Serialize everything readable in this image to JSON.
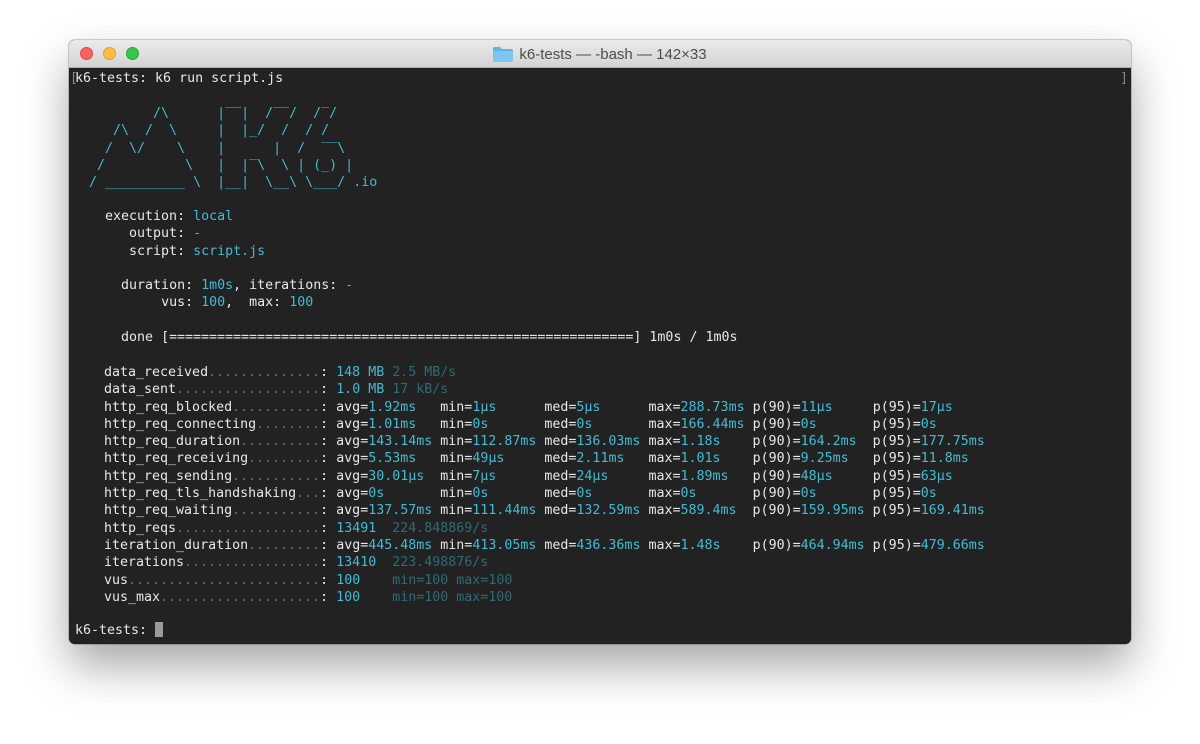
{
  "window": {
    "title": "k6-tests — -bash — 142×33",
    "folder_icon": "folder-icon",
    "traffic_lights": {
      "close": "#fc605c",
      "minimize": "#fdbc40",
      "maximize": "#34c84a"
    }
  },
  "terminal": {
    "bg_color": "#222222",
    "accent_color": "#3fbcd4",
    "command_line": "k6-tests: k6 run script.js",
    "logo": {
      "art": "        /\\      |‾‾|  /‾‾/  /‾/\n   /\\  /  \\     |  |_/  /  / /\n  /  \\/    \\    |      |  /  ‾‾\\\n /          \\   |  |‾\\  \\ | (_) |\n/ __________ \\  |__|  \\__\\ \\___/",
      "suffix": " .io"
    },
    "execution": {
      "execution_label": "execution:",
      "execution_value": "local",
      "output_label": "output:",
      "output_value": "-",
      "script_label": "script:",
      "script_value": "script.js",
      "duration_label": "duration:",
      "duration_value": "1m0s",
      "iterations_label": ", iterations:",
      "iterations_value": "-",
      "vus_label": "vus:",
      "vus_value": "100",
      "max_label": ",  max:",
      "max_value": "100"
    },
    "progress": {
      "label": "done",
      "bar": "[==========================================================]",
      "value_text": "1m0s / 1m0s",
      "fraction": 1.0
    },
    "metrics": [
      {
        "name": "data_received",
        "dots": "..............:",
        "value": "148 MB",
        "rate": "2.5 MB/s"
      },
      {
        "name": "data_sent",
        "dots": "..................:",
        "value": "1.0 MB",
        "rate": "17 kB/s"
      },
      {
        "name": "http_req_blocked",
        "dots": "...........:",
        "avg": "1.92ms",
        "min": "1µs",
        "med": "5µs",
        "max": "288.73ms",
        "p90": "11µs",
        "p95": "17µs"
      },
      {
        "name": "http_req_connecting",
        "dots": "........:",
        "avg": "1.01ms",
        "min": "0s",
        "med": "0s",
        "max": "166.44ms",
        "p90": "0s",
        "p95": "0s"
      },
      {
        "name": "http_req_duration",
        "dots": "..........:",
        "avg": "143.14ms",
        "min": "112.87ms",
        "med": "136.03ms",
        "max": "1.18s",
        "p90": "164.2ms",
        "p95": "177.75ms"
      },
      {
        "name": "http_req_receiving",
        "dots": ".........:",
        "avg": "5.53ms",
        "min": "49µs",
        "med": "2.11ms",
        "max": "1.01s",
        "p90": "9.25ms",
        "p95": "11.8ms"
      },
      {
        "name": "http_req_sending",
        "dots": "...........:",
        "avg": "30.01µs",
        "min": "7µs",
        "med": "24µs",
        "max": "1.89ms",
        "p90": "48µs",
        "p95": "63µs"
      },
      {
        "name": "http_req_tls_handshaking",
        "dots": "...:",
        "avg": "0s",
        "min": "0s",
        "med": "0s",
        "max": "0s",
        "p90": "0s",
        "p95": "0s"
      },
      {
        "name": "http_req_waiting",
        "dots": "...........:",
        "avg": "137.57ms",
        "min": "111.44ms",
        "med": "132.59ms",
        "max": "589.4ms",
        "p90": "159.95ms",
        "p95": "169.41ms"
      },
      {
        "name": "http_reqs",
        "dots": "..................:",
        "value": "13491",
        "rate": "224.848869/s"
      },
      {
        "name": "iteration_duration",
        "dots": ".........:",
        "avg": "445.48ms",
        "min": "413.05ms",
        "med": "436.36ms",
        "max": "1.48s",
        "p90": "464.94ms",
        "p95": "479.66ms"
      },
      {
        "name": "iterations",
        "dots": ".................:",
        "value": "13410",
        "rate": "223.498876/s"
      },
      {
        "name": "vus",
        "dots": "........................:",
        "value": "100",
        "minmax": "min=100 max=100"
      },
      {
        "name": "vus_max",
        "dots": "....................:",
        "value": "100",
        "minmax": "min=100 max=100"
      }
    ],
    "prompt": "k6-tests:"
  }
}
